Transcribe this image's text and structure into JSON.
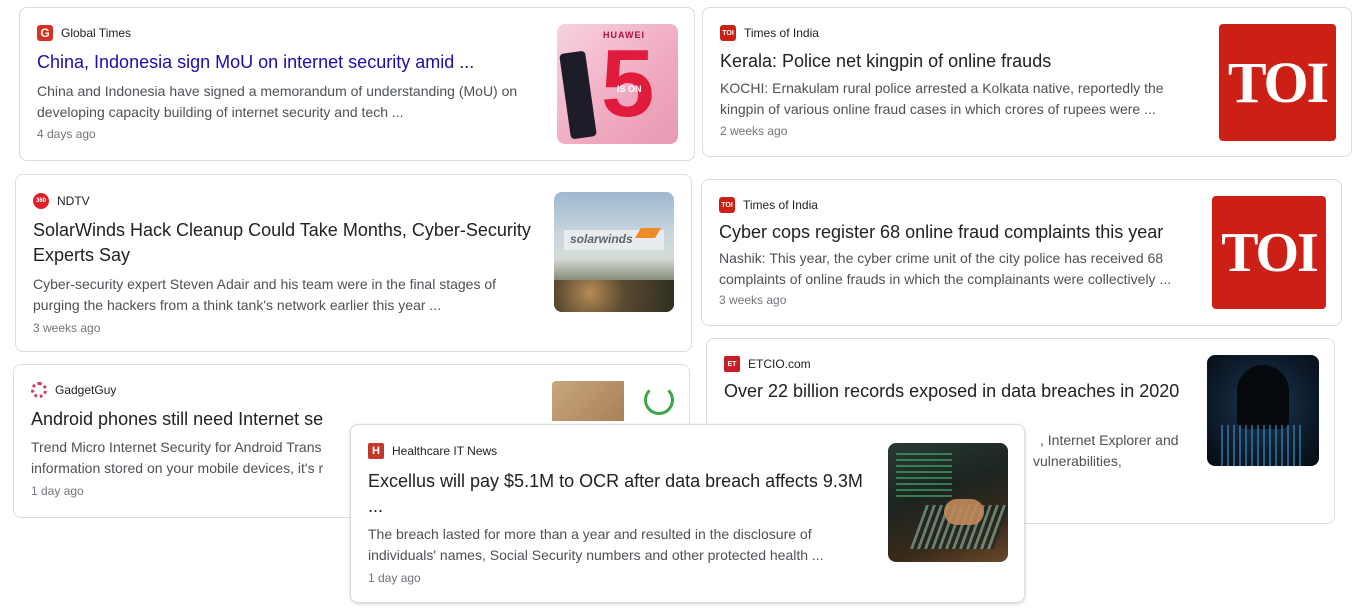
{
  "cards": [
    {
      "source": "Global Times",
      "title": "China, Indonesia sign MoU on internet security amid ...",
      "snippet": "China and Indonesia have signed a memorandum of understanding (MoU) on developing capacity building of internet security and tech ...",
      "age": "4 days ago",
      "thumb_text_1": "HUAWEI",
      "thumb_text_2": "5",
      "thumb_text_3": "IS ON"
    },
    {
      "source": "Times of India",
      "title": "Kerala: Police net kingpin of online frauds",
      "snippet": "KOCHI: Ernakulam rural police arrested a Kolkata native, reportedly the kingpin of various online fraud cases in which crores of rupees were ...",
      "age": "2 weeks ago",
      "thumb_text": "TOI"
    },
    {
      "source": "NDTV",
      "title": "SolarWinds Hack Cleanup Could Take Months, Cyber-Security Experts Say",
      "snippet": "Cyber-security expert Steven Adair and his team were in the final stages of purging the hackers from a think tank's network earlier this year ...",
      "age": "3 weeks ago",
      "thumb_text": "solarwinds"
    },
    {
      "source": "Times of India",
      "title": "Cyber cops register 68 online fraud complaints this year",
      "snippet": "Nashik: This year, the cyber crime unit of the city police has received 68 complaints of online frauds in which the complainants were collectively ...",
      "age": "3 weeks ago",
      "thumb_text": "TOI"
    },
    {
      "source": "ETCIO.com",
      "title": "Over 22 billion records exposed in data breaches in 2020",
      "snippet_1": ", Internet Explorer and",
      "snippet_2": "vulnerabilities,"
    },
    {
      "source": "GadgetGuy",
      "title": "Android phones still need Internet se",
      "snippet_1": "Trend Micro Internet Security for Android Trans",
      "snippet_2": "information stored on your mobile devices, it's r",
      "age": "1 day ago"
    },
    {
      "source": "Healthcare IT News",
      "title": "Excellus will pay $5.1M to OCR after data breach affects 9.3M ...",
      "snippet": "The breach lasted for more than a year and resulted in the disclosure of individuals' names, Social Security numbers and other protected health ...",
      "age": "1 day ago"
    }
  ],
  "favicons": {
    "global_times": "G",
    "toi": "TOI",
    "ndtv": "360",
    "etcio": "ET",
    "healthcare": "H"
  },
  "colors": {
    "link_blue": "#1a0dab",
    "toi_red": "#cc1f16",
    "global_times_red": "#d93025",
    "snippet_gray": "#4d5156",
    "age_gray": "#70757a",
    "border": "#dadce0"
  }
}
